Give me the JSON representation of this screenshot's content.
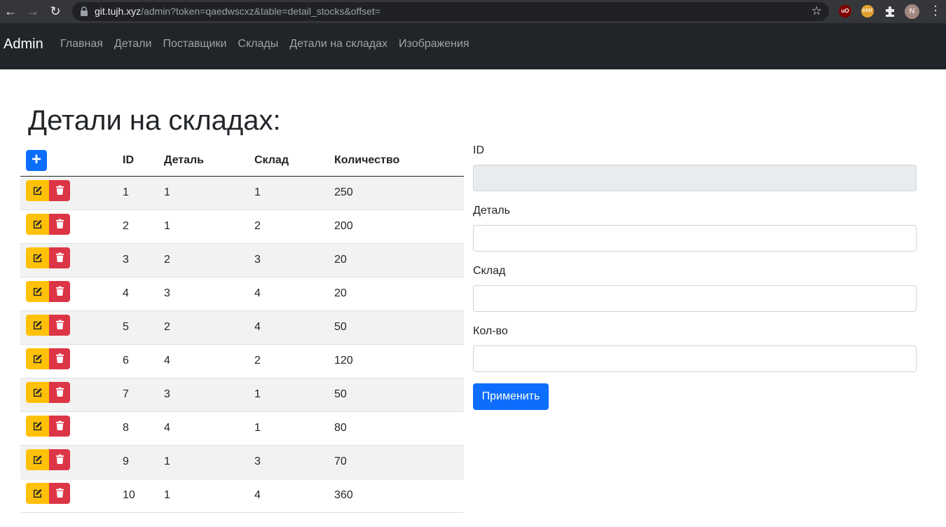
{
  "browser": {
    "url_host": "git.tujh.xyz",
    "url_path": "/admin?token=qaedwscxz&table=detail_stocks&offset=",
    "profile_initial": "N",
    "ext_ublock": "uO",
    "ext_other": "STAT",
    "accent": "#35363a"
  },
  "navbar": {
    "brand": "Admin",
    "links": [
      "Главная",
      "Детали",
      "Поставщики",
      "Склады",
      "Детали на складах",
      "Изображения"
    ]
  },
  "page": {
    "title": "Детали на складах:"
  },
  "table": {
    "add_label": "+",
    "headers": [
      "ID",
      "Деталь",
      "Склад",
      "Количество"
    ],
    "rows": [
      [
        "1",
        "1",
        "1",
        "250"
      ],
      [
        "2",
        "1",
        "2",
        "200"
      ],
      [
        "3",
        "2",
        "3",
        "20"
      ],
      [
        "4",
        "3",
        "4",
        "20"
      ],
      [
        "5",
        "2",
        "4",
        "50"
      ],
      [
        "6",
        "4",
        "2",
        "120"
      ],
      [
        "7",
        "3",
        "1",
        "50"
      ],
      [
        "8",
        "4",
        "1",
        "80"
      ],
      [
        "9",
        "1",
        "3",
        "70"
      ],
      [
        "10",
        "1",
        "4",
        "360"
      ]
    ],
    "edit_icon": "pen-square-icon",
    "delete_icon": "trash-icon",
    "edit_color": "#ffc107",
    "delete_color": "#dc3545"
  },
  "form": {
    "fields": [
      {
        "label": "ID",
        "value": "",
        "readonly": true
      },
      {
        "label": "Деталь",
        "value": ""
      },
      {
        "label": "Склад",
        "value": ""
      },
      {
        "label": "Кол-во",
        "value": ""
      }
    ],
    "submit_label": "Применить",
    "primary_color": "#0d6efd"
  }
}
